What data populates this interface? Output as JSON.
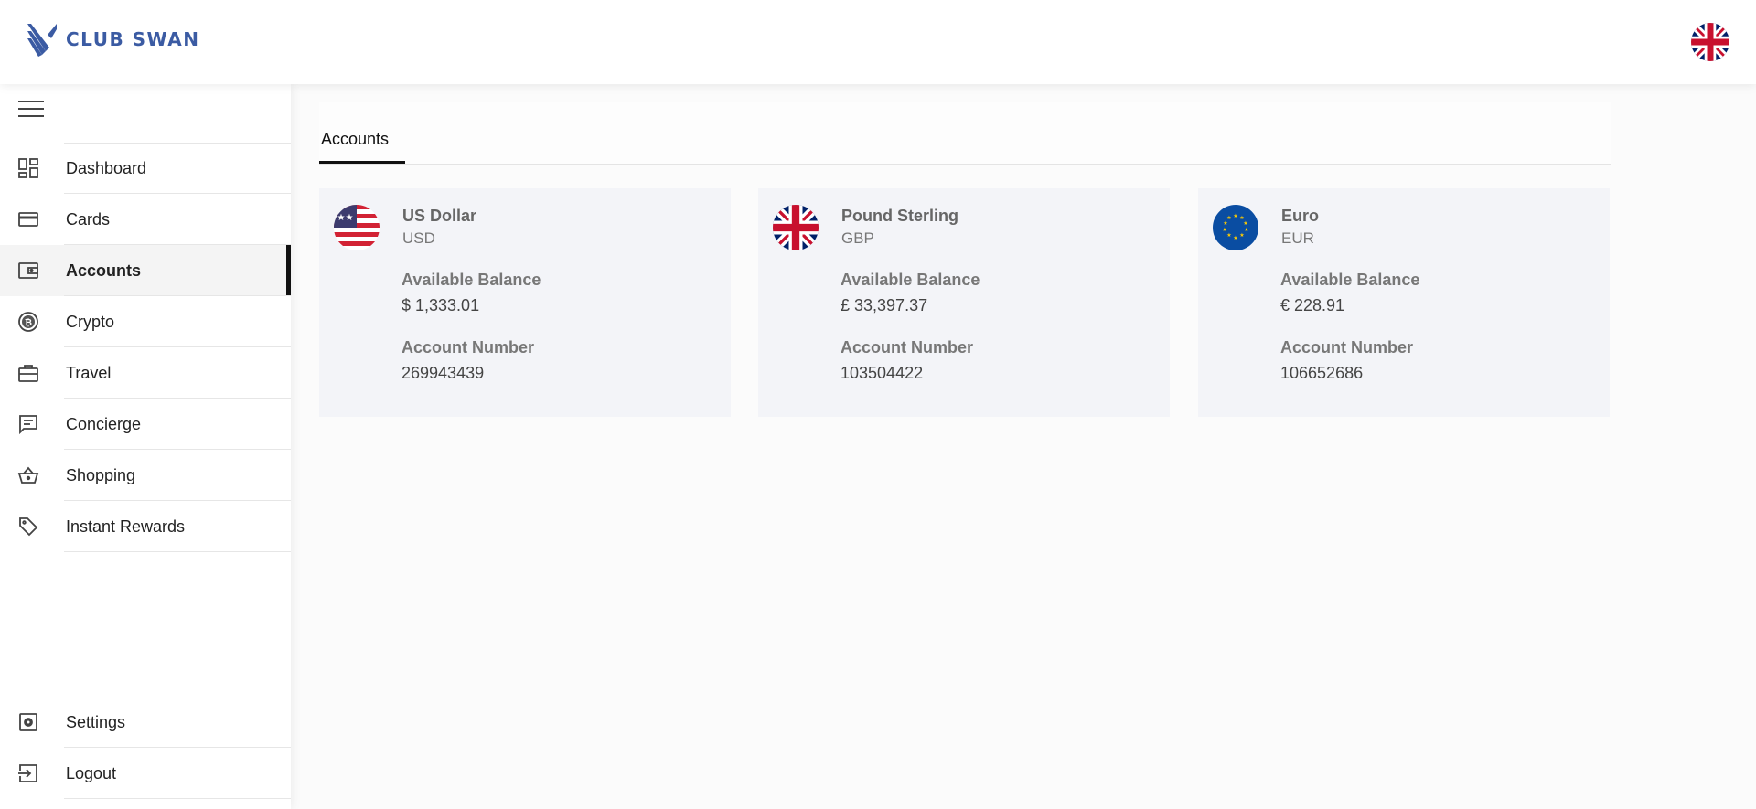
{
  "brand": {
    "name": "CLUB SWAN",
    "color": "#3b5ba3"
  },
  "header": {
    "language_flag": "uk-flag-icon"
  },
  "sidebar": {
    "menu_icon": "hamburger-icon",
    "items": [
      {
        "label": "Dashboard",
        "icon": "dashboard-icon"
      },
      {
        "label": "Cards",
        "icon": "card-icon"
      },
      {
        "label": "Accounts",
        "icon": "wallet-icon",
        "active": true
      },
      {
        "label": "Crypto",
        "icon": "bitcoin-icon"
      },
      {
        "label": "Travel",
        "icon": "briefcase-icon"
      },
      {
        "label": "Concierge",
        "icon": "chat-icon"
      },
      {
        "label": "Shopping",
        "icon": "basket-icon"
      },
      {
        "label": "Instant Rewards",
        "icon": "tag-icon"
      }
    ],
    "bottom_items": [
      {
        "label": "Settings",
        "icon": "settings-icon"
      },
      {
        "label": "Logout",
        "icon": "logout-icon"
      }
    ]
  },
  "main": {
    "tabs": [
      {
        "label": "Accounts",
        "active": true
      }
    ],
    "accounts": [
      {
        "currency_name": "US Dollar",
        "code": "USD",
        "balance_label": "Available Balance",
        "balance": "$ 1,333.01",
        "number_label": "Account Number",
        "number": "269943439",
        "flag": "us-flag-icon"
      },
      {
        "currency_name": "Pound Sterling",
        "code": "GBP",
        "balance_label": "Available Balance",
        "balance": "£ 33,397.37",
        "number_label": "Account Number",
        "number": "103504422",
        "flag": "uk-flag-icon"
      },
      {
        "currency_name": "Euro",
        "code": "EUR",
        "balance_label": "Available Balance",
        "balance": "€ 228.91",
        "number_label": "Account Number",
        "number": "106652686",
        "flag": "eu-flag-icon"
      }
    ]
  }
}
